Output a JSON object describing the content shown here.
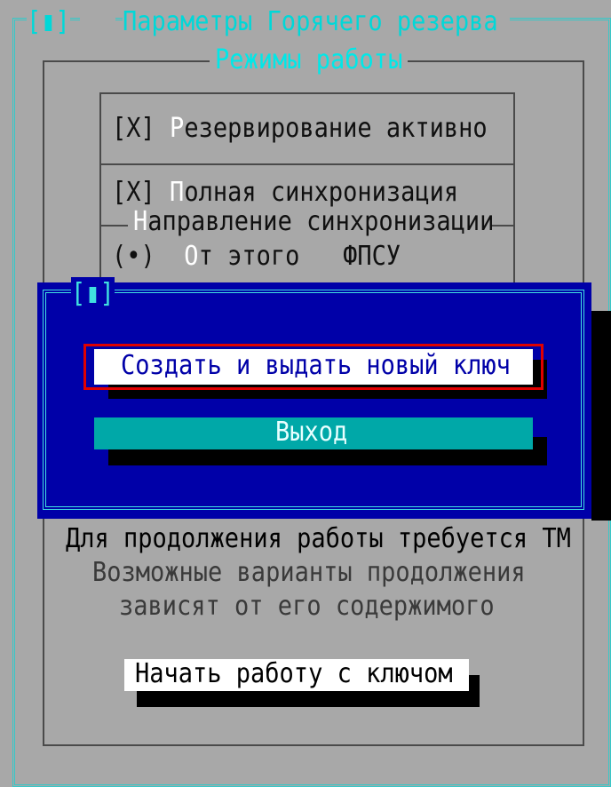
{
  "window": {
    "close_bracket": "[▮]",
    "title": "Параметры Горячего резерва"
  },
  "modes_group": {
    "title": "Режимы работы",
    "redundancy": {
      "check": "[X]",
      "hot": "Р",
      "rest": "езервирование активно"
    },
    "full_sync": {
      "check": "[X]",
      "hot": "П",
      "rest": "олная синхронизация"
    },
    "direction": {
      "label_hot": "Н",
      "label_rest": "аправление синхронизации",
      "option": {
        "radio": "(•)",
        "hot": "О",
        "rest": "т этого",
        "suffix": "ФПСУ"
      }
    }
  },
  "dialog": {
    "close_bracket": "[▮]",
    "create_button": "Создать и выдать новый ключ",
    "exit_button": "Выход"
  },
  "info": {
    "line1": "Для продолжения работы требуется ТМ",
    "line2": "Возможные варианты продолжения",
    "line3": "зависят от его содержимого"
  },
  "start_button": "Начать работу с ключом",
  "colors": {
    "background": "#a8a8a8",
    "accent_cyan": "#38c8c8",
    "dialog_blue": "#0000a8",
    "selection_red": "#e00000"
  }
}
